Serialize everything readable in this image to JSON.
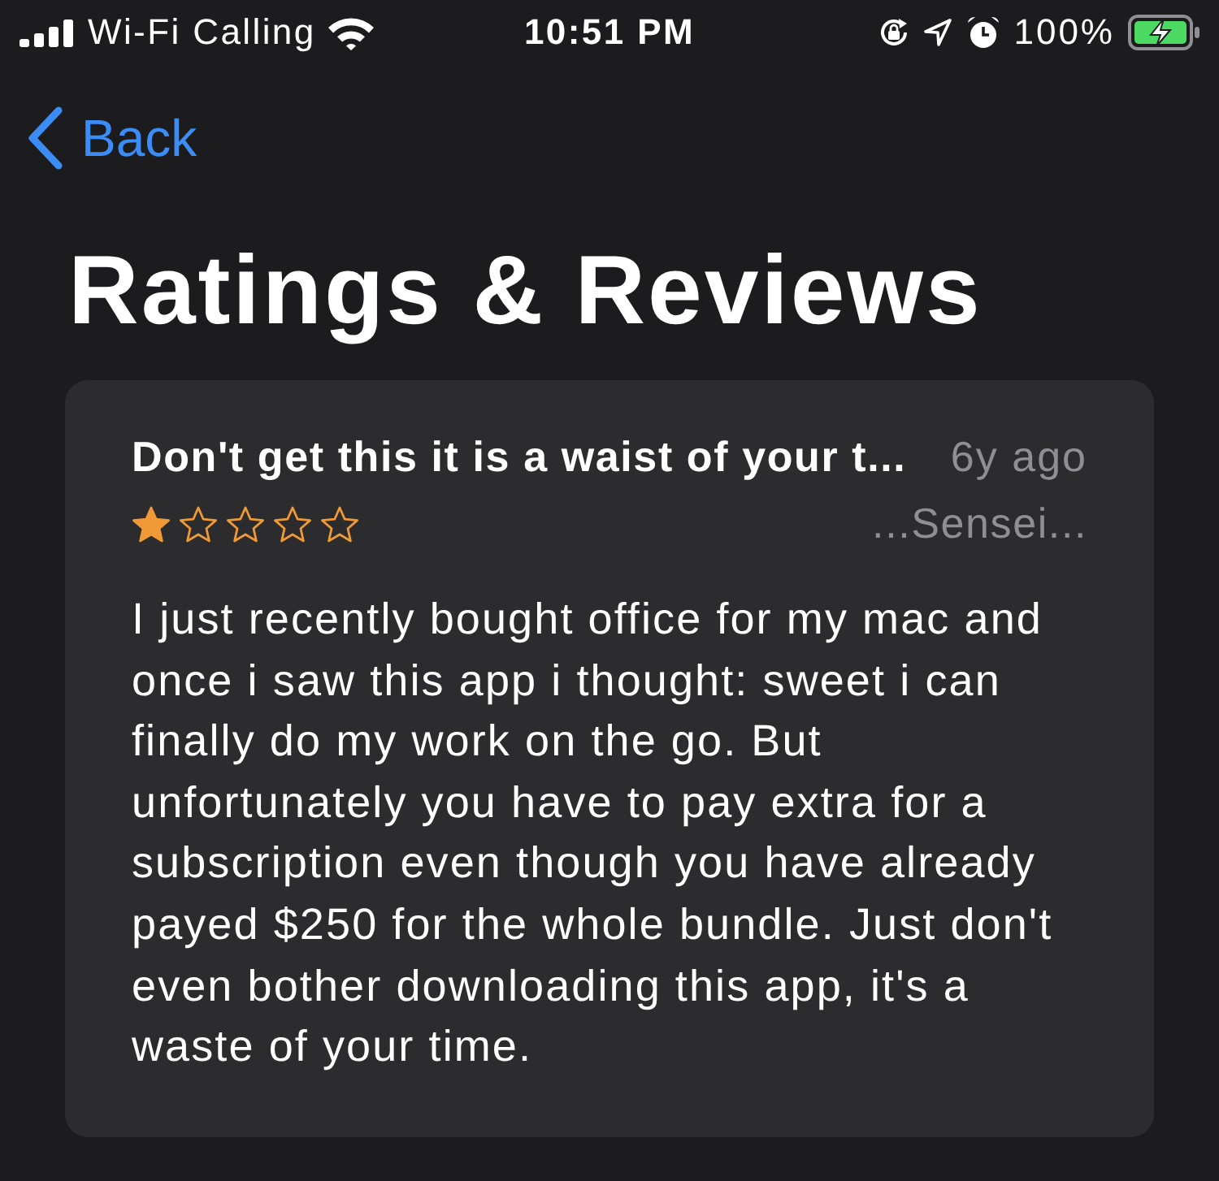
{
  "status_bar": {
    "carrier": "Wi-Fi Calling",
    "time": "10:51 PM",
    "battery_text": "100%"
  },
  "nav": {
    "back_label": "Back"
  },
  "title": "Ratings & Reviews",
  "reviews": [
    {
      "title": "Don't get this it is a waist of your t...",
      "date": "6y ago",
      "stars": 1,
      "author": "...Sensei...",
      "body": "I just recently bought office for my mac and once i saw this app i thought: sweet i can finally do my work on the go. But unfortunately you have to pay extra for a subscription even though you have already payed $250 for the whole bundle. Just don't even bother downloading this app, it's a waste of your time."
    }
  ]
}
